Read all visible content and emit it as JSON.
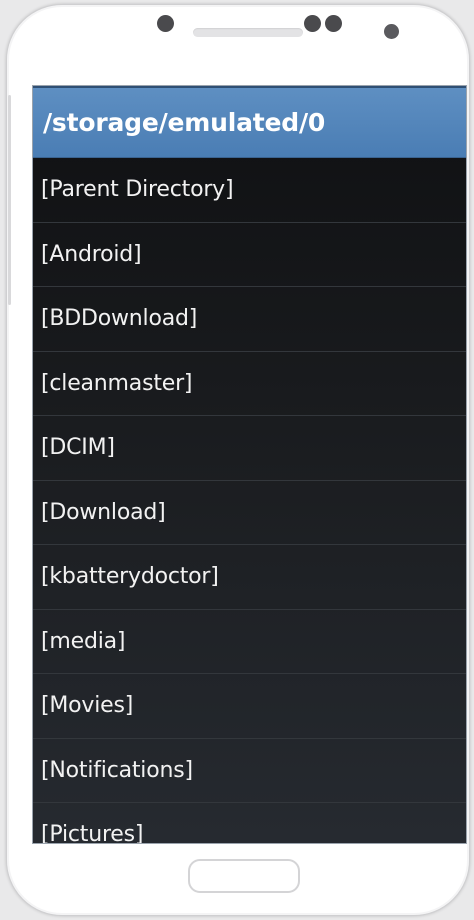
{
  "header": {
    "path": "/storage/emulated/0"
  },
  "entries": [
    {
      "label": "[Parent Directory]"
    },
    {
      "label": "[Android]"
    },
    {
      "label": "[BDDownload]"
    },
    {
      "label": "[cleanmaster]"
    },
    {
      "label": "[DCIM]"
    },
    {
      "label": "[Download]"
    },
    {
      "label": "[kbatterydoctor]"
    },
    {
      "label": "[media]"
    },
    {
      "label": "[Movies]"
    },
    {
      "label": "[Notifications]"
    },
    {
      "label": "[Pictures]"
    }
  ],
  "colors": {
    "header_blue": "#4a7db4",
    "list_background": "#15171a",
    "text": "#f2f2f2"
  }
}
